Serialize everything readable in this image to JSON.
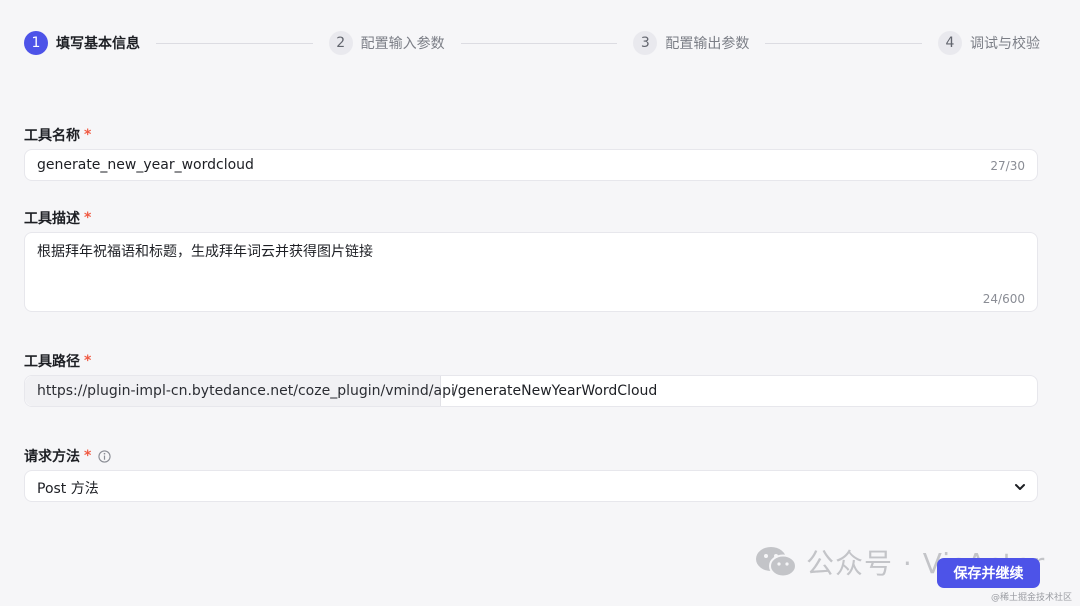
{
  "stepper": {
    "steps": [
      {
        "number": "1",
        "label": "填写基本信息",
        "active": true
      },
      {
        "number": "2",
        "label": "配置输入参数",
        "active": false
      },
      {
        "number": "3",
        "label": "配置输出参数",
        "active": false
      },
      {
        "number": "4",
        "label": "调试与校验",
        "active": false
      }
    ]
  },
  "form": {
    "required_mark": "*",
    "tool_name": {
      "label": "工具名称",
      "value": "generate_new_year_wordcloud",
      "counter": "27/30"
    },
    "tool_description": {
      "label": "工具描述",
      "value": "根据拜年祝福语和标题，生成拜年词云并获得图片链接",
      "counter": "24/600"
    },
    "tool_path": {
      "label": "工具路径",
      "prefix": "https://plugin-impl-cn.bytedance.net/coze_plugin/vmind/api",
      "value": "/generateNewYearWordCloud"
    },
    "request_method": {
      "label": "请求方法",
      "selected": "Post 方法"
    }
  },
  "actions": {
    "save_continue_label": "保存并继续"
  },
  "watermark": {
    "main_text": "公众号 · VisActor",
    "small_text": "@稀土掘金技术社区"
  },
  "colors": {
    "accent": "#4d53e8",
    "required": "#f05a42",
    "background": "#f6f6f8"
  },
  "icons": {
    "info": "info-circle-icon",
    "select": "chevron-down-icon",
    "watermark_logo": "wechat-icon"
  }
}
